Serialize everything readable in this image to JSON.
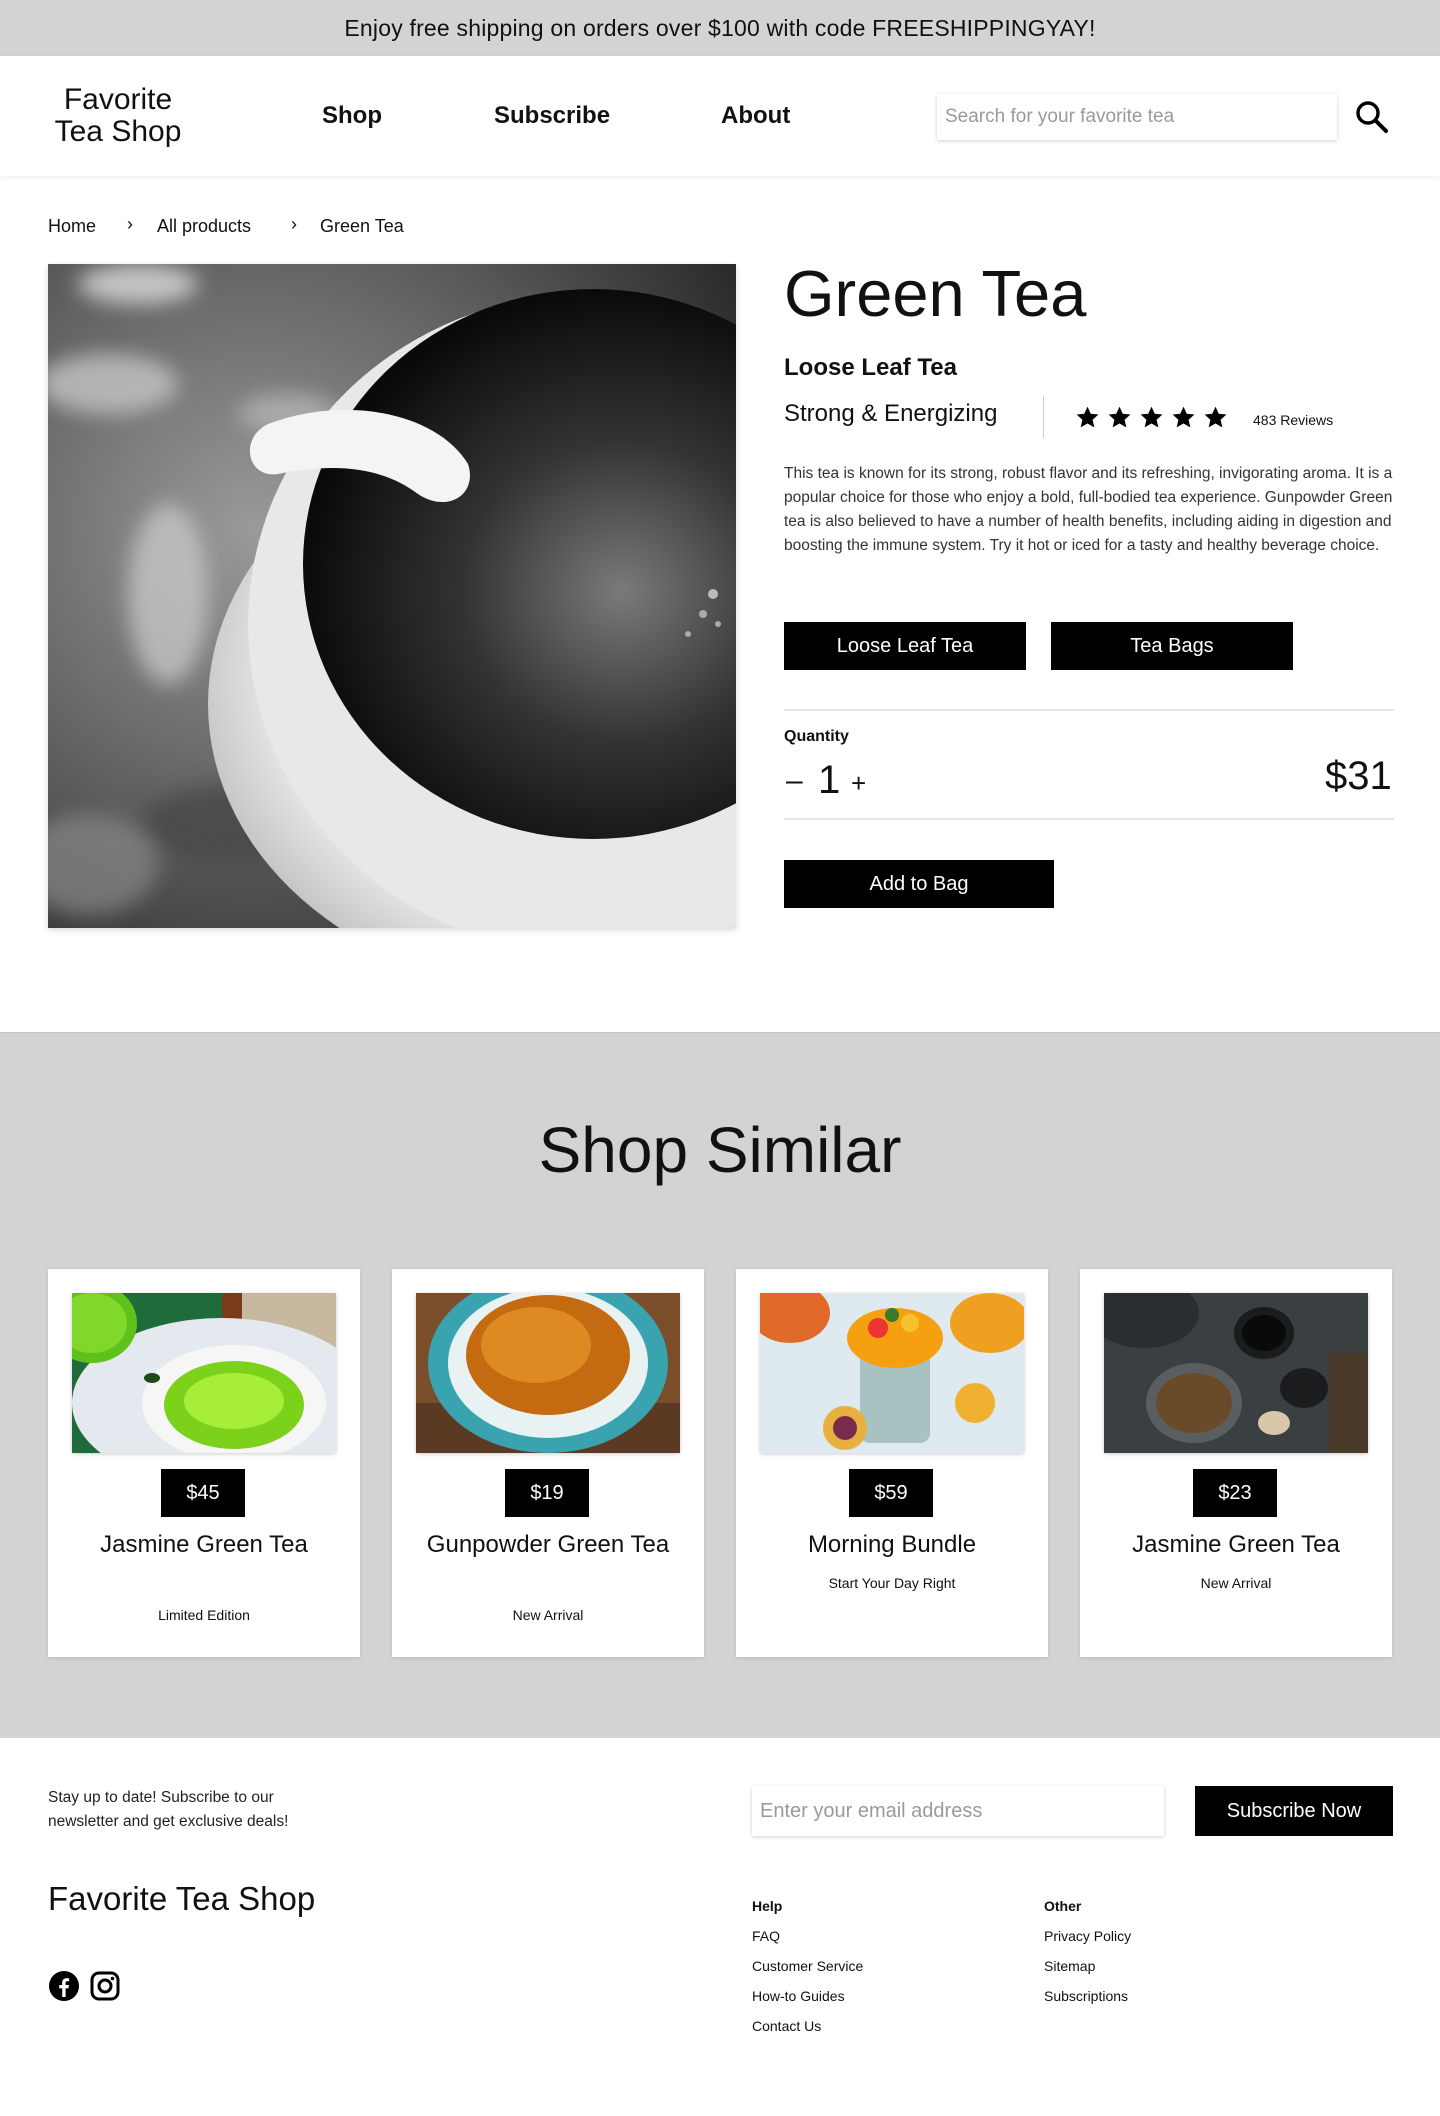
{
  "promo": {
    "text": "Enjoy free shipping on orders over $100 with code FREESHIPPINGYAY!"
  },
  "header": {
    "logo_line1": "Favorite",
    "logo_line2": "Tea Shop",
    "nav": [
      "Shop",
      "Subscribe",
      "About"
    ],
    "search_placeholder": "Search for your favorite tea",
    "search_icon": "magnifier-icon"
  },
  "breadcrumb": [
    "Home",
    "All products",
    "Green Tea"
  ],
  "product": {
    "title": "Green Tea",
    "subtitle": "Loose Leaf Tea",
    "tagline": "Strong & Energizing",
    "rating": 5,
    "reviews": "483 Reviews",
    "description": "This tea is known for its strong, robust flavor and its refreshing, invigorating aroma. It is a popular choice for those who enjoy a bold, full-bodied tea experience. Gunpowder Green tea is also believed to have a number of health benefits, including aiding in digestion and boosting the immune system. Try it hot or iced for a tasty and healthy beverage choice.",
    "options": [
      "Loose Leaf Tea",
      "Tea Bags"
    ],
    "quantity_label": "Quantity",
    "quantity": "1",
    "minus": "–",
    "plus": "+",
    "price": "$31",
    "add_to_bag": "Add to Bag"
  },
  "similar": {
    "title": "Shop Similar",
    "cards": [
      {
        "price": "$45",
        "name": "Jasmine Green Tea",
        "sub": "Limited Edition"
      },
      {
        "price": "$19",
        "name": "Gunpowder Green Tea",
        "sub": "New Arrival"
      },
      {
        "price": "$59",
        "name": "Morning Bundle",
        "sub": "Start Your Day Right"
      },
      {
        "price": "$23",
        "name": "Jasmine Green Tea",
        "sub": "New Arrival"
      }
    ]
  },
  "footer": {
    "newsletter": "Stay up to date! Subscribe to our newsletter and get exclusive deals!",
    "email_placeholder": "Enter your email address",
    "subscribe_button": "Subscribe Now",
    "logo": "Favorite Tea Shop",
    "help_title": "Help",
    "help_links": [
      "FAQ",
      "Customer Service",
      "How-to Guides",
      "Contact Us"
    ],
    "other_title": "Other",
    "other_links": [
      "Privacy Policy",
      "Sitemap",
      "Subscriptions"
    ],
    "social": [
      "facebook-icon",
      "instagram-icon"
    ]
  },
  "colors": {
    "accent": "#000000",
    "band": "#d3d3d3"
  }
}
